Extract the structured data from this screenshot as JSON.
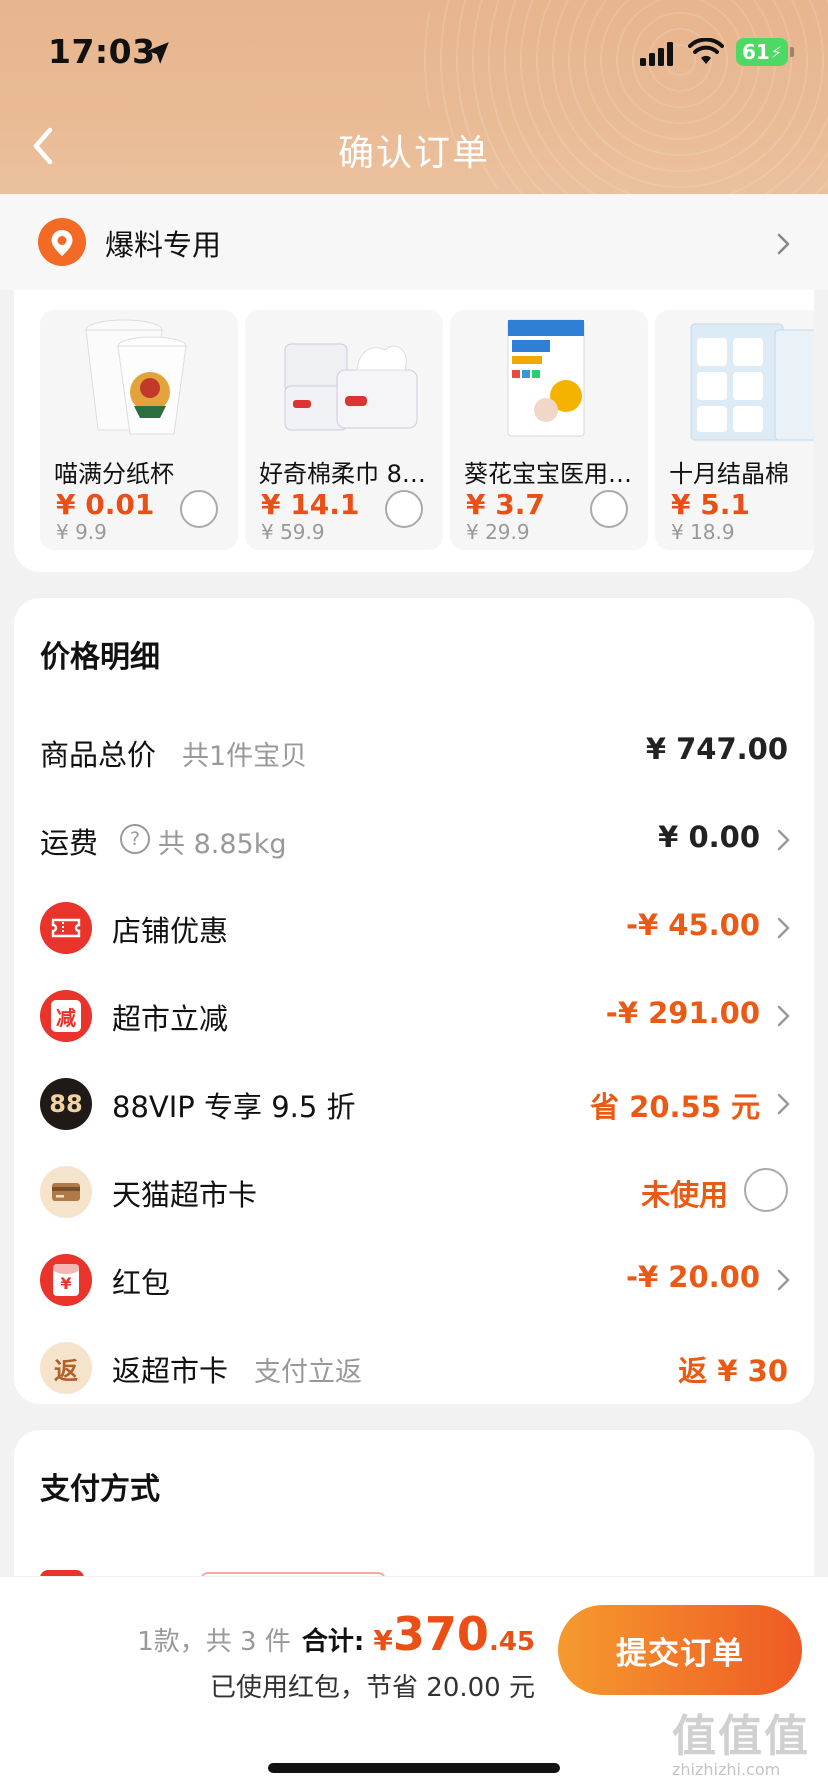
{
  "status_bar": {
    "time": "17:03",
    "battery": "61",
    "icons": [
      "location-arrow-icon",
      "signal-icon",
      "wifi-icon",
      "battery-charging-icon"
    ]
  },
  "header": {
    "title": "确认订单",
    "back_icon": "chevron-left-icon"
  },
  "address": {
    "icon": "location-pin-icon",
    "text": "爆料专用"
  },
  "products": [
    {
      "name": "喵满分纸杯",
      "price": "¥ 0.01",
      "original": "¥ 9.9"
    },
    {
      "name": "好奇棉柔巾 8…",
      "price": "¥ 14.1",
      "original": "¥ 59.9"
    },
    {
      "name": "葵花宝宝医用…",
      "price": "¥ 3.7",
      "original": "¥ 29.9"
    },
    {
      "name": "十月结晶棉",
      "price": "¥ 5.1",
      "original": "¥ 18.9"
    }
  ],
  "price_detail": {
    "title": "价格明细",
    "rows": [
      {
        "label": "商品总价",
        "sub": "共1件宝贝",
        "value": "¥ 747.00"
      },
      {
        "label": "运费",
        "sub": "共 8.85kg",
        "value": "¥ 0.00"
      },
      {
        "label": "店铺优惠",
        "value": "-¥ 45.00",
        "icon": "ticket-icon"
      },
      {
        "label": "超市立减",
        "value": "-¥ 291.00",
        "icon": "discount-badge-icon",
        "icon_text": "减"
      },
      {
        "label": "88VIP 专享 9.5 折",
        "value": "省 20.55 元",
        "icon": "vip-88-icon",
        "icon_text": "88"
      },
      {
        "label": "天猫超市卡",
        "value": "未使用",
        "icon": "card-icon"
      },
      {
        "label": "红包",
        "value": "-¥ 20.00",
        "icon": "red-envelope-icon",
        "icon_text": "¥"
      },
      {
        "label": "返超市卡",
        "sub": "支付立返",
        "value": "返 ¥ 30",
        "icon": "cashback-icon",
        "icon_text": "返"
      }
    ]
  },
  "payment": {
    "title": "支付方式"
  },
  "bottom_bar": {
    "count": "1款，共 3 件",
    "total_label": "合计:",
    "currency": "¥",
    "total_int": "370",
    "total_dec": ".45",
    "savings": "已使用红包，节省 20.00 元",
    "submit_label": "提交订单"
  },
  "watermark": {
    "text": "值值值",
    "site": "zhizhizhi.com"
  },
  "colors": {
    "accent": "#ea4f16",
    "header": "#e8b891",
    "submit_gradient_start": "#f59a2e",
    "submit_gradient_end": "#ef5a24"
  }
}
